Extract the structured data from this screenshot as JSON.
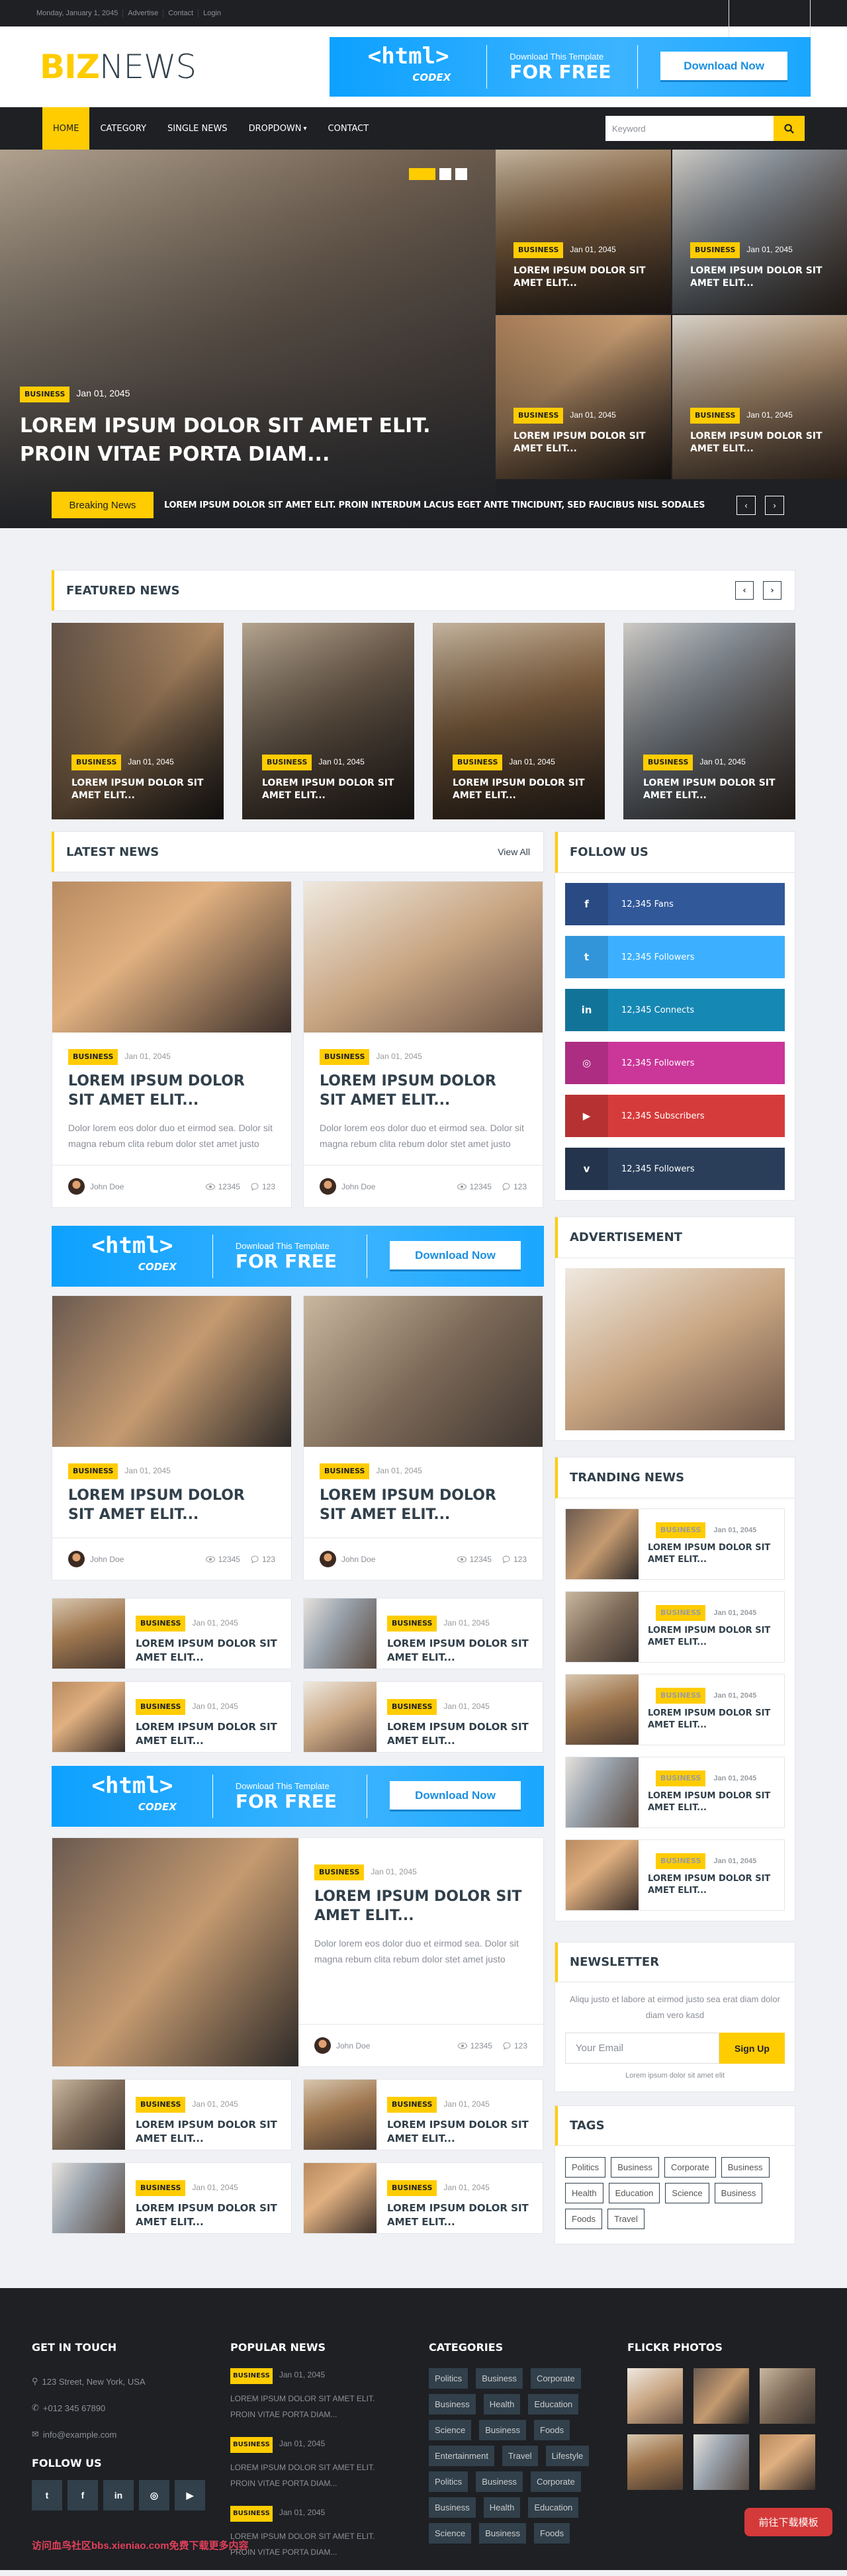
{
  "colors": {
    "accent": "#FFCC00",
    "dark": "#1E2024",
    "heading": "#31404B",
    "ad_blue": "#0DA1FF"
  },
  "topbar": {
    "date": "Monday, January 1, 2045",
    "links": [
      "Advertise",
      "Contact",
      "Login"
    ],
    "social": [
      "twitter-icon",
      "facebook-icon",
      "linkedin-icon",
      "instagram-icon",
      "google-plus-icon",
      "youtube-icon"
    ]
  },
  "header": {
    "logo_a": "BIZ",
    "logo_b": "NEWS"
  },
  "ad": {
    "brand": "<html>",
    "brand_sub": "CODEX",
    "line1": "Download This Template",
    "line2": "FOR FREE",
    "button": "Download Now"
  },
  "nav": {
    "items": [
      "HOME",
      "CATEGORY",
      "SINGLE NEWS",
      "DROPDOWN",
      "CONTACT"
    ],
    "active": 0,
    "dropdown_index": 3,
    "search_placeholder": "Keyword"
  },
  "hero": {
    "main": {
      "category": "BUSINESS",
      "date": "Jan 01, 2045",
      "title": "LOREM IPSUM DOLOR SIT AMET ELIT. PROIN VITAE PORTA DIAM..."
    },
    "slides": 3,
    "active_slide": 0,
    "tiles": [
      {
        "category": "BUSINESS",
        "date": "Jan 01, 2045",
        "title": "LOREM IPSUM DOLOR SIT AMET ELIT..."
      },
      {
        "category": "BUSINESS",
        "date": "Jan 01, 2045",
        "title": "LOREM IPSUM DOLOR SIT AMET ELIT..."
      },
      {
        "category": "BUSINESS",
        "date": "Jan 01, 2045",
        "title": "LOREM IPSUM DOLOR SIT AMET ELIT..."
      },
      {
        "category": "BUSINESS",
        "date": "Jan 01, 2045",
        "title": "LOREM IPSUM DOLOR SIT AMET ELIT..."
      }
    ]
  },
  "breaking": {
    "label": "Breaking News",
    "text": "LOREM IPSUM DOLOR SIT AMET ELIT. PROIN INTERDUM LACUS EGET ANTE TINCIDUNT, SED FAUCIBUS NISL SODALES"
  },
  "featured": {
    "title": "FEATURED NEWS",
    "cards": [
      {
        "category": "BUSINESS",
        "date": "Jan 01, 2045",
        "title": "LOREM IPSUM DOLOR SIT AMET ELIT..."
      },
      {
        "category": "BUSINESS",
        "date": "Jan 01, 2045",
        "title": "LOREM IPSUM DOLOR SIT AMET ELIT..."
      },
      {
        "category": "BUSINESS",
        "date": "Jan 01, 2045",
        "title": "LOREM IPSUM DOLOR SIT AMET ELIT..."
      },
      {
        "category": "BUSINESS",
        "date": "Jan 01, 2045",
        "title": "LOREM IPSUM DOLOR SIT AMET ELIT..."
      }
    ]
  },
  "latest": {
    "title": "LATEST NEWS",
    "view_all": "View All",
    "cards_row1": [
      {
        "category": "BUSINESS",
        "date": "Jan 01, 2045",
        "title": "LOREM IPSUM DOLOR SIT AMET ELIT...",
        "excerpt": "Dolor lorem eos dolor duo et eirmod sea. Dolor sit magna rebum clita rebum dolor stet amet justo",
        "author": "John Doe",
        "views": "12345",
        "comments": "123"
      },
      {
        "category": "BUSINESS",
        "date": "Jan 01, 2045",
        "title": "LOREM IPSUM DOLOR SIT AMET ELIT...",
        "excerpt": "Dolor lorem eos dolor duo et eirmod sea. Dolor sit magna rebum clita rebum dolor stet amet justo",
        "author": "John Doe",
        "views": "12345",
        "comments": "123"
      }
    ],
    "cards_row2": [
      {
        "category": "BUSINESS",
        "date": "Jan 01, 2045",
        "title": "LOREM IPSUM DOLOR SIT AMET ELIT...",
        "author": "John Doe",
        "views": "12345",
        "comments": "123"
      },
      {
        "category": "BUSINESS",
        "date": "Jan 01, 2045",
        "title": "LOREM IPSUM DOLOR SIT AMET ELIT...",
        "author": "John Doe",
        "views": "12345",
        "comments": "123"
      }
    ],
    "list_row1": [
      {
        "category": "BUSINESS",
        "date": "Jan 01, 2045",
        "title": "LOREM IPSUM DOLOR SIT AMET ELIT..."
      },
      {
        "category": "BUSINESS",
        "date": "Jan 01, 2045",
        "title": "LOREM IPSUM DOLOR SIT AMET ELIT..."
      },
      {
        "category": "BUSINESS",
        "date": "Jan 01, 2045",
        "title": "LOREM IPSUM DOLOR SIT AMET ELIT..."
      },
      {
        "category": "BUSINESS",
        "date": "Jan 01, 2045",
        "title": "LOREM IPSUM DOLOR SIT AMET ELIT..."
      }
    ],
    "wide_card": {
      "category": "BUSINESS",
      "date": "Jan 01, 2045",
      "title": "LOREM IPSUM DOLOR SIT AMET ELIT...",
      "excerpt": "Dolor lorem eos dolor duo et eirmod sea. Dolor sit magna rebum clita rebum dolor stet amet justo",
      "author": "John Doe",
      "views": "12345",
      "comments": "123"
    },
    "list_row2": [
      {
        "category": "BUSINESS",
        "date": "Jan 01, 2045",
        "title": "LOREM IPSUM DOLOR SIT AMET ELIT..."
      },
      {
        "category": "BUSINESS",
        "date": "Jan 01, 2045",
        "title": "LOREM IPSUM DOLOR SIT AMET ELIT..."
      },
      {
        "category": "BUSINESS",
        "date": "Jan 01, 2045",
        "title": "LOREM IPSUM DOLOR SIT AMET ELIT..."
      },
      {
        "category": "BUSINESS",
        "date": "Jan 01, 2045",
        "title": "LOREM IPSUM DOLOR SIT AMET ELIT..."
      }
    ]
  },
  "sidebar": {
    "follow": {
      "title": "FOLLOW US",
      "items": [
        {
          "icon": "facebook-icon",
          "glyph": "f",
          "label": "12,345 Fans",
          "color": "#315899"
        },
        {
          "icon": "twitter-icon",
          "glyph": "t",
          "label": "12,345 Followers",
          "color": "#3CB0FF"
        },
        {
          "icon": "linkedin-icon",
          "glyph": "in",
          "label": "12,345 Connects",
          "color": "#1688B4"
        },
        {
          "icon": "instagram-icon",
          "glyph": "◎",
          "label": "12,345 Followers",
          "color": "#CB3699"
        },
        {
          "icon": "youtube-icon",
          "glyph": "▶",
          "label": "12,345 Subscribers",
          "color": "#D63B3B"
        },
        {
          "icon": "vimeo-icon",
          "glyph": "v",
          "label": "12,345 Followers",
          "color": "#2A3E5A"
        }
      ]
    },
    "advertisement": {
      "title": "ADVERTISEMENT"
    },
    "trending": {
      "title": "TRANDING NEWS",
      "items": [
        {
          "category": "BUSINESS",
          "date": "Jan 01, 2045",
          "title": "LOREM IPSUM DOLOR SIT AMET ELIT..."
        },
        {
          "category": "BUSINESS",
          "date": "Jan 01, 2045",
          "title": "LOREM IPSUM DOLOR SIT AMET ELIT..."
        },
        {
          "category": "BUSINESS",
          "date": "Jan 01, 2045",
          "title": "LOREM IPSUM DOLOR SIT AMET ELIT..."
        },
        {
          "category": "BUSINESS",
          "date": "Jan 01, 2045",
          "title": "LOREM IPSUM DOLOR SIT AMET ELIT..."
        },
        {
          "category": "BUSINESS",
          "date": "Jan 01, 2045",
          "title": "LOREM IPSUM DOLOR SIT AMET ELIT..."
        }
      ]
    },
    "newsletter": {
      "title": "NEWSLETTER",
      "text": "Aliqu justo et labore at eirmod justo sea erat diam dolor diam vero kasd",
      "placeholder": "Your Email",
      "button": "Sign Up",
      "note": "Lorem ipsum dolor sit amet elit"
    },
    "tags": {
      "title": "TAGS",
      "items": [
        "Politics",
        "Business",
        "Corporate",
        "Business",
        "Health",
        "Education",
        "Science",
        "Business",
        "Foods",
        "Travel"
      ]
    }
  },
  "footer": {
    "contact": {
      "title": "GET IN TOUCH",
      "address": "123 Street, New York, USA",
      "phone": "+012 345 67890",
      "email": "info@example.com"
    },
    "follow": {
      "title": "FOLLOW US",
      "items": [
        "twitter-icon",
        "facebook-icon",
        "linkedin-icon",
        "instagram-icon",
        "youtube-icon"
      ]
    },
    "popular": {
      "title": "POPULAR NEWS",
      "items": [
        {
          "category": "BUSINESS",
          "date": "Jan 01, 2045",
          "title": "LOREM IPSUM DOLOR SIT AMET ELIT. PROIN VITAE PORTA DIAM..."
        },
        {
          "category": "BUSINESS",
          "date": "Jan 01, 2045",
          "title": "LOREM IPSUM DOLOR SIT AMET ELIT. PROIN VITAE PORTA DIAM..."
        },
        {
          "category": "BUSINESS",
          "date": "Jan 01, 2045",
          "title": "LOREM IPSUM DOLOR SIT AMET ELIT. PROIN VITAE PORTA DIAM..."
        }
      ]
    },
    "categories": {
      "title": "CATEGORIES",
      "items": [
        "Politics",
        "Business",
        "Corporate",
        "Business",
        "Health",
        "Education",
        "Science",
        "Business",
        "Foods",
        "Entertainment",
        "Travel",
        "Lifestyle",
        "Politics",
        "Business",
        "Corporate",
        "Business",
        "Health",
        "Education",
        "Science",
        "Business",
        "Foods"
      ]
    },
    "flickr": {
      "title": "FLICKR PHOTOS",
      "count": 6
    },
    "download_button": "前往下载模板",
    "watermark": "访问血鸟社区bbs.xieniao.com免费下载更多内容"
  }
}
